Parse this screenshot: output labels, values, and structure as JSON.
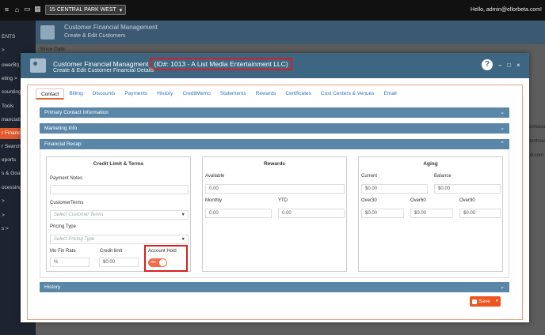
{
  "topbar": {
    "location": "15 CENTRAL PARK WEST",
    "greeting": "Hello, admin@ellorbeta.com!",
    "icons": [
      "menu-icon",
      "home-icon",
      "truck-icon",
      "calculator-icon",
      "phone-icon"
    ]
  },
  "sidebar": {
    "items": [
      "ENTS",
      ">",
      "owerBI)",
      "eting >",
      "counting",
      "Tools",
      "inancials",
      "r Financi",
      "r Search",
      "eports",
      "s & Goal",
      "ocessing",
      ">",
      ">",
      "s >"
    ],
    "active_index": 7
  },
  "background": {
    "title": "Customer Financial Management",
    "subtitle": "Create & Edit Customers",
    "since_label": "Since Date:",
    "right_texts": [
      "enhouse",
      "ttenhouse",
      "ell.com"
    ]
  },
  "modal": {
    "title": "Customer Financial Managment",
    "id_label": "(ID#: 1013 - A List Media Entertainment LLC)",
    "subtitle": "Create & Edit Customer Financial Details",
    "help": "?",
    "minimize": "–",
    "maximize": "□",
    "close": "×",
    "tabs": [
      "Contact",
      "Billing",
      "Discounts",
      "Payments",
      "History",
      "CreditMemo",
      "Statements",
      "Rewards",
      "Certificates",
      "Cost Centers & Venues",
      "Email"
    ],
    "active_tab": 0,
    "sections": {
      "primary_contact": "Primary Contact Information",
      "marketing": "Marketing Info",
      "financial_recap": "Financial Recap",
      "history": "History"
    },
    "credit": {
      "title": "Credit Limit & Terms",
      "payment_notes_label": "Payment Notes",
      "payment_notes_value": "",
      "customer_terms_label": "CustomerTerms",
      "customer_terms_placeholder": "Select Customer Terms",
      "pricing_type_label": "Pricing Type",
      "pricing_type_placeholder": "Select Pricing Type",
      "mo_fin_rate_label": "Mo Fin Rate",
      "mo_fin_rate_value": "%",
      "credit_limit_label": "Credit limit",
      "credit_limit_value": "$0.00",
      "account_hold_label": "Account Hold",
      "account_hold_toggle": "ON"
    },
    "rewards": {
      "title": "Rewards",
      "available_label": "Available",
      "available_value": "0.00",
      "monthly_label": "Monthly",
      "monthly_value": "0.00",
      "ytd_label": "YTD",
      "ytd_value": "0.00"
    },
    "aging": {
      "title": "Aging",
      "current_label": "Current",
      "current_value": "$0.00",
      "balance_label": "Balance",
      "balance_value": "$0.00",
      "over30_label": "Over30",
      "over30_value": "$0.00",
      "over60_label": "Over60",
      "over60_value": "$0.00",
      "over90_label": "Over90",
      "over90_value": "$0.00"
    },
    "save_label": "Save"
  },
  "colors": {
    "header_blue": "#3d6682",
    "panel_blue": "#5a87a8",
    "accent_orange": "#f0541e",
    "highlight_red": "#d62020"
  }
}
